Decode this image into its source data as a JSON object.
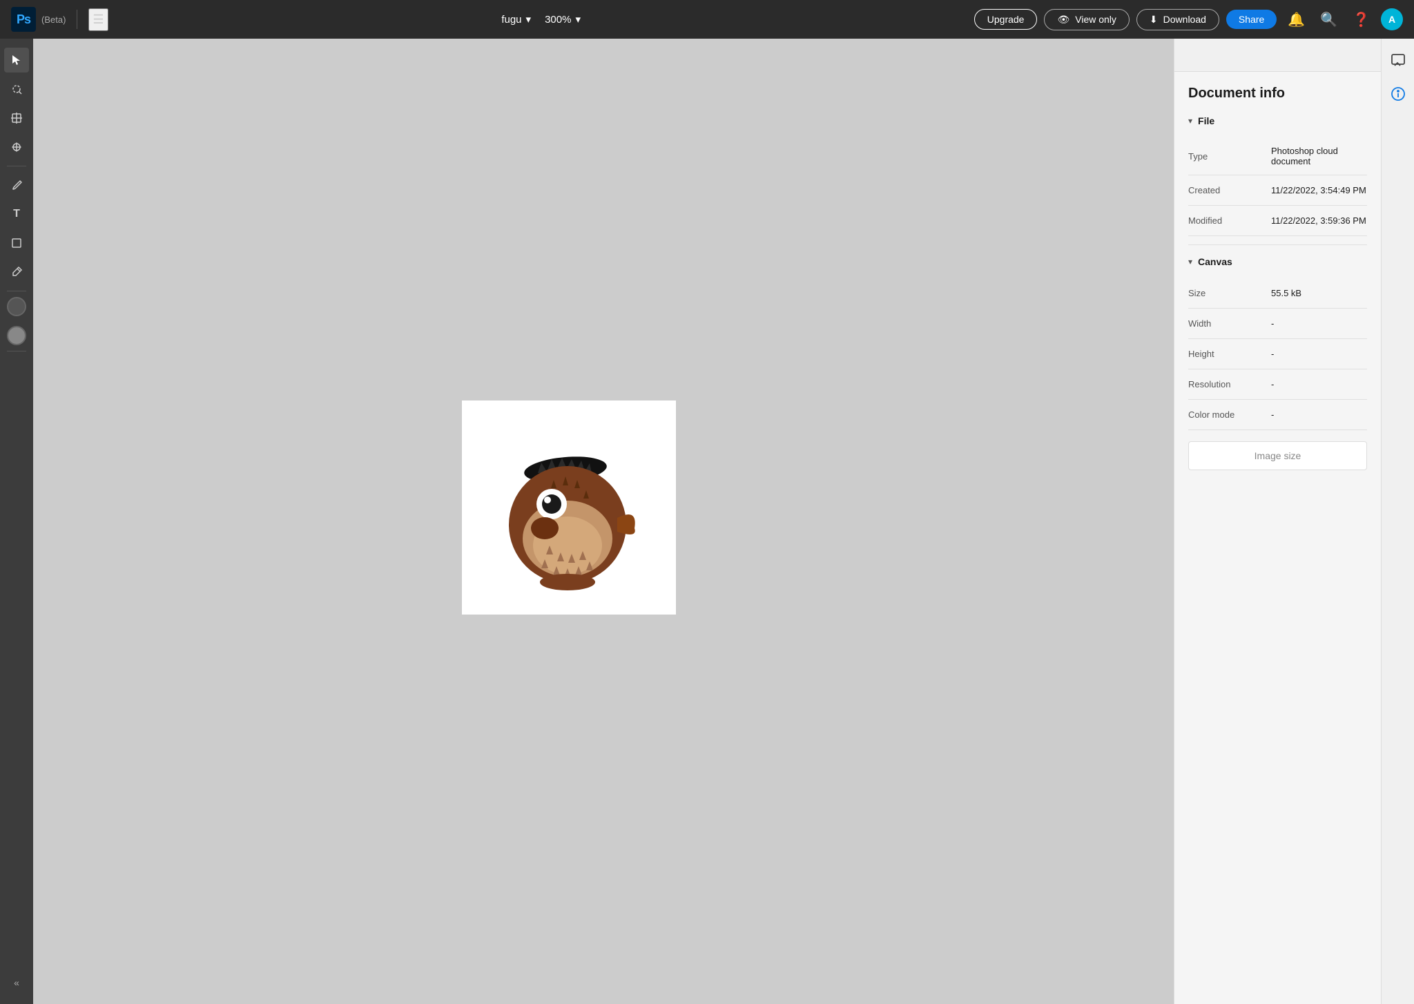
{
  "app": {
    "name": "Ps",
    "beta_label": "(Beta)"
  },
  "header": {
    "filename": "fugu",
    "zoom": "300%",
    "upgrade_label": "Upgrade",
    "view_only_label": "View only",
    "download_label": "Download",
    "share_label": "Share"
  },
  "toolbar": {
    "tools": [
      {
        "name": "select",
        "icon": "↖",
        "active": true
      },
      {
        "name": "lasso",
        "icon": "⊙"
      },
      {
        "name": "transform",
        "icon": "⊞"
      },
      {
        "name": "heal",
        "icon": "✦"
      },
      {
        "name": "brush",
        "icon": "✏"
      },
      {
        "name": "text",
        "icon": "T"
      },
      {
        "name": "shape",
        "icon": "❖"
      },
      {
        "name": "eyedropper",
        "icon": "⚗"
      }
    ],
    "foreground_color": "#555555",
    "background_color": "#888888"
  },
  "document_info": {
    "title": "Document info",
    "file_section": {
      "label": "File",
      "fields": [
        {
          "label": "Type",
          "value": "Photoshop cloud document"
        },
        {
          "label": "Created",
          "value": "11/22/2022, 3:54:49 PM"
        },
        {
          "label": "Modified",
          "value": "11/22/2022, 3:59:36 PM"
        }
      ]
    },
    "canvas_section": {
      "label": "Canvas",
      "fields": [
        {
          "label": "Size",
          "value": "55.5 kB"
        },
        {
          "label": "Width",
          "value": "-"
        },
        {
          "label": "Height",
          "value": "-"
        },
        {
          "label": "Resolution",
          "value": "-"
        },
        {
          "label": "Color mode",
          "value": "-"
        }
      ]
    },
    "image_size_button": "Image size"
  }
}
